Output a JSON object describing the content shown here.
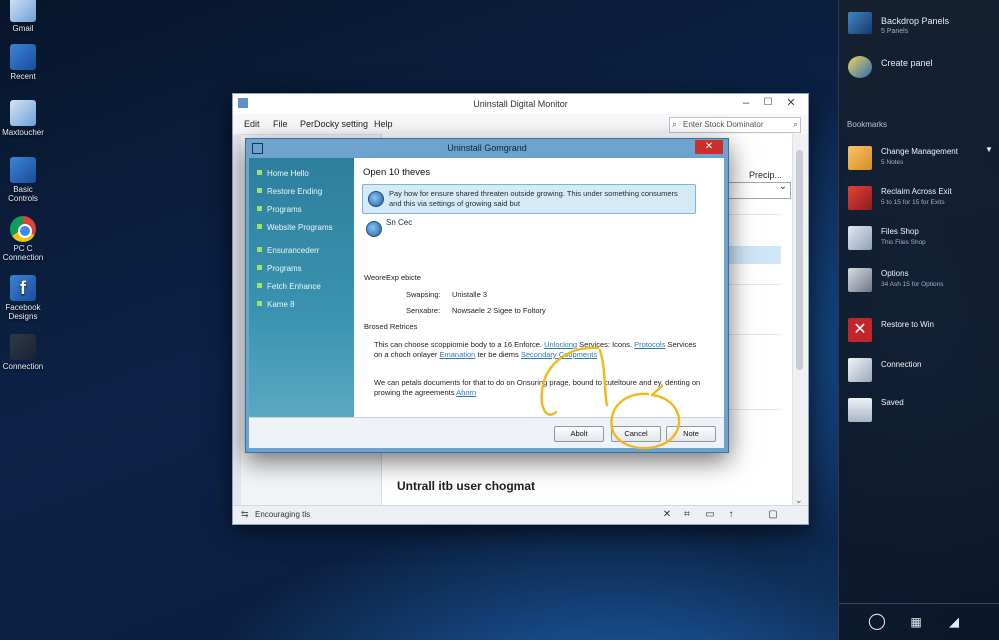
{
  "desktop": {
    "icons": [
      {
        "name": "desktop-icon-gmail",
        "label": "Gmail"
      },
      {
        "name": "desktop-icon-recent",
        "label": "Recent"
      },
      {
        "name": "desktop-icon-maxtoucher",
        "label": "Maxtoucher"
      },
      {
        "name": "desktop-icon-basic-controls",
        "label": "Basic Controls"
      },
      {
        "name": "desktop-icon-pc-connection",
        "label": "PC C Connection"
      },
      {
        "name": "desktop-icon-facebook",
        "label": "Facebook Designs"
      },
      {
        "name": "desktop-icon-connection",
        "label": "Connection"
      }
    ]
  },
  "right_panel": {
    "top_items": [
      {
        "title": "Backdrop Panels",
        "sub": "5 Panels"
      },
      {
        "title": "Create panel",
        "sub": ""
      }
    ],
    "section_label": "Bookmarks",
    "items": [
      {
        "title": "Change Management",
        "sub": "5 Notes"
      },
      {
        "title": "Reclaim Across Exit",
        "sub": "5 to 15 for 15 for Exits"
      },
      {
        "title": "Files Shop",
        "sub": "This Files Shop"
      },
      {
        "title": "Options",
        "sub": "34 Ash 15 for Options"
      },
      {
        "title": "Restore to Win",
        "sub": ""
      },
      {
        "title": "Connection",
        "sub": ""
      },
      {
        "title": "Saved",
        "sub": ""
      }
    ]
  },
  "main_window": {
    "title": "Uninstall Digital Monitor",
    "menu": [
      "Edit",
      "File",
      "PerDocky setting",
      "Help"
    ],
    "search_placeholder": "Enter Stock Dominator",
    "right_label": "Precip...",
    "section_heading": "Untrall itb user chogmat",
    "status_text": "Encouraging tls",
    "status_icons": [
      "x",
      "crop",
      "view",
      "up",
      "stop"
    ]
  },
  "dialog": {
    "title": "Uninstall Gomgrand",
    "close_label": "✕",
    "nav_items": [
      "Home Hello",
      "Restore Ending",
      "Programs",
      "Website Programs",
      "Ensurancederr",
      "Programs",
      "Fetch Enhance",
      "Kame 8"
    ],
    "heading": "Open 10 theves",
    "option1_text": "Pay how for ensure shared threaten outside growing. This under something consumers and this via settings of growing said but",
    "option2_text": "Sn Cec",
    "subheading": "WeoreExp ebicte",
    "field1_label": "Swapsing:",
    "field1_value": "Unistalle 3",
    "field2_label": "Senxabre:",
    "field2_value": "Nowsaele 2 Sigee to Foltory",
    "section_label": "Brosed Retrices",
    "para1_text": "This can choose scoppiomie body to a 16 Enforce.",
    "para1_link1": "Unlocking",
    "para1_text2": "Services: Icons.",
    "para1_link2": "Protocols",
    "para1_text3": "Services on a choch onlayer",
    "para1_link3": "Emanation",
    "para1_text4": "ter be diems",
    "para1_link4": "Secondary Coopments",
    "para2_text": "We can petals documents for that to do on Onsuring prage, bound to cuteltoure and ey, denting on prowing the agreements",
    "para2_link": "Ahorn",
    "buttons": {
      "back": "Abolt",
      "cancel": "Cancel",
      "next": "Note"
    }
  }
}
